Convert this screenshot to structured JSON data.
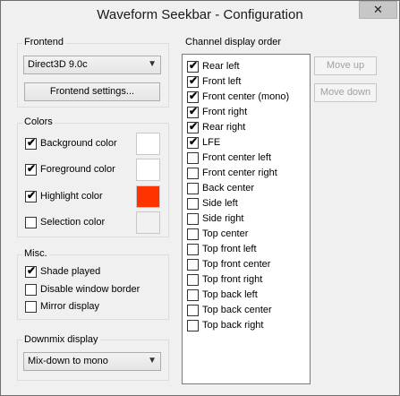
{
  "window": {
    "title": "Waveform Seekbar - Configuration",
    "close_symbol": "✕"
  },
  "frontend": {
    "label": "Frontend",
    "selected": "Direct3D 9.0c",
    "settings_button": "Frontend settings..."
  },
  "colors": {
    "label": "Colors",
    "items": [
      {
        "label": "Background color",
        "checked": true,
        "swatch": "#ffffff"
      },
      {
        "label": "Foreground color",
        "checked": true,
        "swatch": "#ffffff"
      },
      {
        "label": "Highlight color",
        "checked": true,
        "swatch": "#ff3300"
      },
      {
        "label": "Selection color",
        "checked": false,
        "swatch": "#f0f0f0"
      }
    ]
  },
  "misc": {
    "label": "Misc.",
    "items": [
      {
        "label": "Shade played",
        "checked": true
      },
      {
        "label": "Disable window border",
        "checked": false
      },
      {
        "label": "Mirror display",
        "checked": false
      }
    ]
  },
  "downmix": {
    "label": "Downmix display",
    "selected": "Mix-down to mono"
  },
  "channels": {
    "label": "Channel display order",
    "items": [
      {
        "label": "Rear left",
        "checked": true
      },
      {
        "label": "Front left",
        "checked": true
      },
      {
        "label": "Front center (mono)",
        "checked": true
      },
      {
        "label": "Front right",
        "checked": true
      },
      {
        "label": "Rear right",
        "checked": true
      },
      {
        "label": "LFE",
        "checked": true
      },
      {
        "label": "Front center left",
        "checked": false
      },
      {
        "label": "Front center right",
        "checked": false
      },
      {
        "label": "Back center",
        "checked": false
      },
      {
        "label": "Side left",
        "checked": false
      },
      {
        "label": "Side right",
        "checked": false
      },
      {
        "label": "Top center",
        "checked": false
      },
      {
        "label": "Top front left",
        "checked": false
      },
      {
        "label": "Top front center",
        "checked": false
      },
      {
        "label": "Top front right",
        "checked": false
      },
      {
        "label": "Top back left",
        "checked": false
      },
      {
        "label": "Top back center",
        "checked": false
      },
      {
        "label": "Top back right",
        "checked": false
      }
    ],
    "move_up": "Move up",
    "move_down": "Move down"
  }
}
